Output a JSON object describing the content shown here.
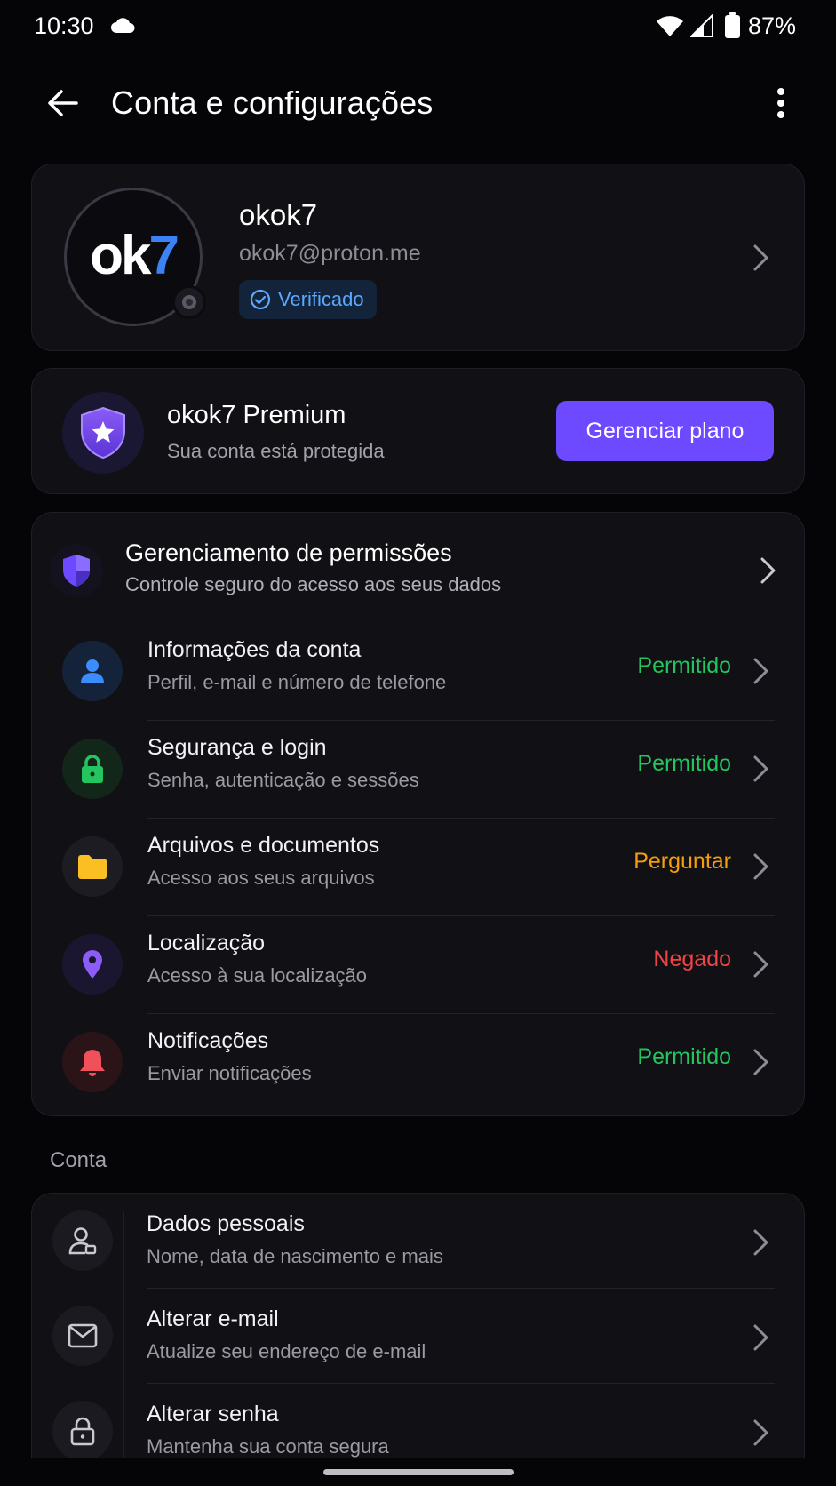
{
  "status_bar": {
    "time": "10:30",
    "battery": "87%"
  },
  "app_bar": {
    "title": "Conta e configurações"
  },
  "profile": {
    "avatar_text_main": "ok",
    "avatar_text_accent": "7",
    "name": "okok7",
    "email": "okok7@proton.me",
    "badge": "Verificado"
  },
  "premium": {
    "title": "okok7 Premium",
    "subtitle": "Sua conta está protegida",
    "button": "Gerenciar plano"
  },
  "permissions": {
    "title": "Gerenciamento de permissões",
    "subtitle": "Controle seguro do acesso aos seus dados",
    "items": [
      {
        "title": "Informações da conta",
        "subtitle": "Perfil, e-mail e número de telefone",
        "status": "Permitido",
        "status_color": "#22c55e",
        "icon": "person-icon"
      },
      {
        "title": "Segurança e login",
        "subtitle": "Senha, autenticação e sessões",
        "status": "Permitido",
        "status_color": "#22c55e",
        "icon": "lock-icon"
      },
      {
        "title": "Arquivos e documentos",
        "subtitle": "Acesso aos seus arquivos",
        "status": "Perguntar",
        "status_color": "#f59e0b",
        "icon": "folder-icon"
      },
      {
        "title": "Localização",
        "subtitle": "Acesso à sua localização",
        "status": "Negado",
        "status_color": "#ef4444",
        "icon": "location-pin-icon"
      },
      {
        "title": "Notificações",
        "subtitle": "Enviar notificações",
        "status": "Permitido",
        "status_color": "#22c55e",
        "icon": "bell-icon"
      }
    ]
  },
  "account_section": {
    "label": "Conta",
    "items": [
      {
        "title": "Dados pessoais",
        "subtitle": "Nome, data de nascimento e mais",
        "icon": "user-card-icon"
      },
      {
        "title": "Alterar e-mail",
        "subtitle": "Atualize seu endereço de e-mail",
        "icon": "envelope-icon"
      },
      {
        "title": "Alterar senha",
        "subtitle": "Mantenha sua conta segura",
        "icon": "padlock-icon"
      }
    ]
  },
  "colors": {
    "accent": "#6d4aff",
    "allowed": "#22c55e",
    "ask": "#f59e0b",
    "denied": "#ef4444",
    "verified": "#5aa8ff"
  }
}
